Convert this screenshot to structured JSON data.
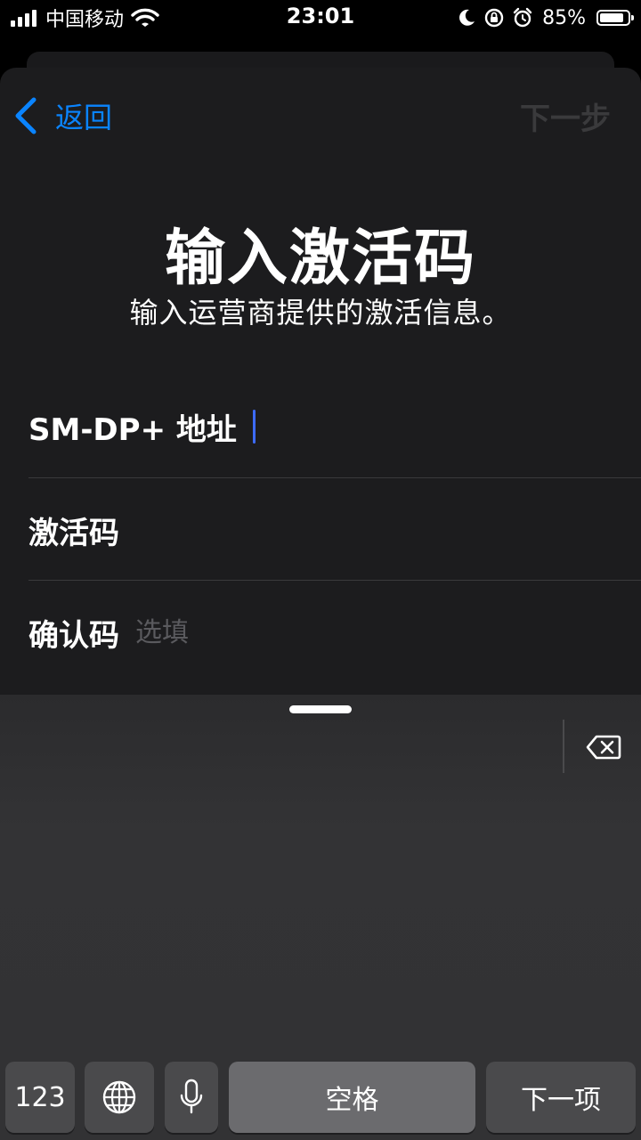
{
  "status_bar": {
    "carrier": "中国移动",
    "time": "23:01",
    "battery_percent": "85%",
    "battery_level": 0.85,
    "icons": [
      "signal-icon",
      "wifi-icon",
      "moon-icon",
      "rotation-lock-icon",
      "alarm-icon",
      "battery-icon"
    ]
  },
  "nav": {
    "back_label": "返回",
    "next_label": "下一步"
  },
  "header": {
    "title": "输入激活码",
    "subtitle": "输入运营商提供的激活信息。"
  },
  "form": {
    "sm_dp_label": "SM-DP+ 地址",
    "activation_code_label": "激活码",
    "confirmation_code_label": "确认码",
    "confirmation_code_placeholder": "选填"
  },
  "keyboard": {
    "numbers_key": "123",
    "space_key": "空格",
    "next_key": "下一项"
  },
  "colors": {
    "accent": "#0a84ff",
    "caret": "#3d6bff",
    "sheet_bg": "#1c1c1e",
    "disabled_text": "#3a3a3c"
  }
}
